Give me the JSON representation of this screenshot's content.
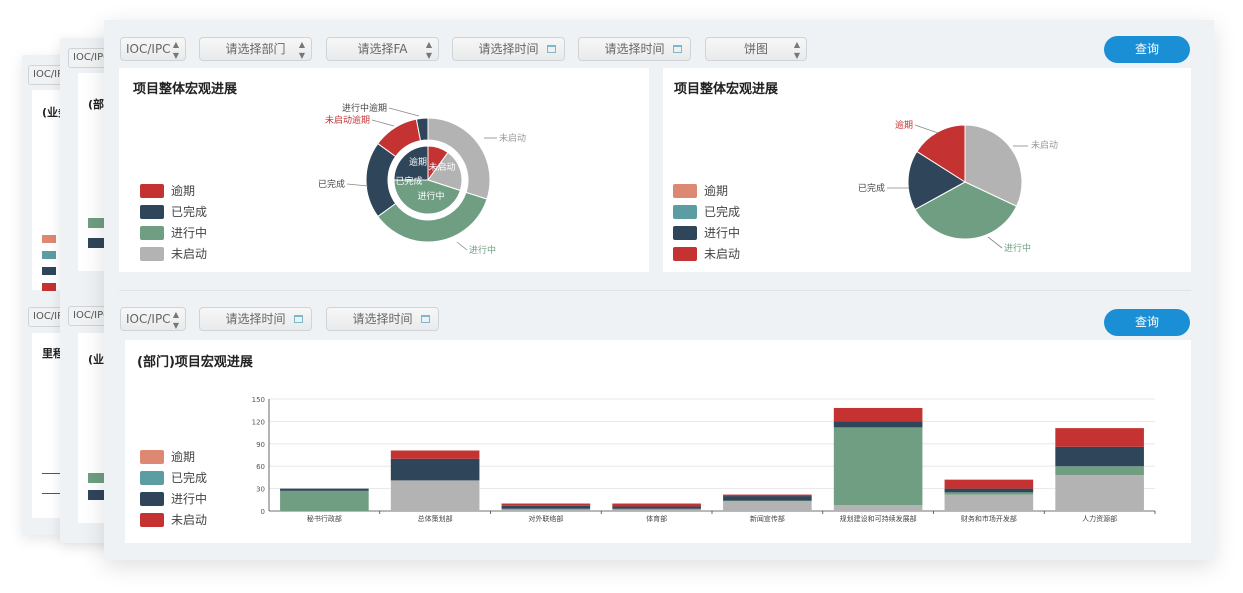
{
  "colors": {
    "overdue": "#c43232",
    "done": "#2f455a",
    "progress": "#6f9e82",
    "notstarted": "#b3b3b3",
    "overdue_light": "#dc8873",
    "done_light": "#5b9da3",
    "primary": "#1a8fd6"
  },
  "back_cards": {
    "card1": {
      "filter": "IOC/IPC",
      "title1": "(业务",
      "title2": "里程"
    },
    "card2": {
      "filter": "IOC/IPC",
      "title1": "(部门",
      "title2": "(业务"
    }
  },
  "filters_top": {
    "ioc": "IOC/IPC",
    "department": "请选择部门",
    "fa": "请选择FA",
    "time_start": "请选择时间",
    "time_end": "请选择时间",
    "chart_type": "饼图",
    "query": "查询"
  },
  "filters_bottom": {
    "ioc": "IOC/IPC",
    "time_start": "请选择时间",
    "time_end": "请选择时间",
    "query": "查询"
  },
  "panel_left": {
    "title": "项目整体宏观进展",
    "legend": [
      "逾期",
      "已完成",
      "进行中",
      "未启动"
    ],
    "outer_labels": {
      "in_progress_overdue": "进行中逾期",
      "notstarted_overdue": "未启动逾期",
      "done": "已完成",
      "notstarted": "未启动",
      "in_progress": "进行中"
    },
    "inner_labels": {
      "overdue": "逾期",
      "notstarted": "未启动",
      "done": "已完成",
      "in_progress": "进行中"
    }
  },
  "panel_right": {
    "title": "项目整体宏观进展",
    "legend": [
      "逾期",
      "已完成",
      "进行中",
      "未启动"
    ],
    "labels": {
      "overdue": "逾期",
      "notstarted": "未启动",
      "done": "已完成",
      "in_progress": "进行中"
    }
  },
  "panel_bottom": {
    "title": "(部门)项目宏观进展",
    "legend": [
      "逾期",
      "已完成",
      "进行中",
      "未启动"
    ]
  },
  "chart_data": [
    {
      "type": "pie",
      "title": "项目整体宏观进展",
      "rings": [
        {
          "name": "inner",
          "slices": [
            {
              "label": "逾期",
              "value": 10
            },
            {
              "label": "未启动",
              "value": 20
            },
            {
              "label": "进行中",
              "value": 45
            },
            {
              "label": "已完成",
              "value": 25
            }
          ]
        },
        {
          "name": "outer",
          "slices": [
            {
              "label": "未启动",
              "value": 30
            },
            {
              "label": "进行中",
              "value": 35
            },
            {
              "label": "已完成",
              "value": 20
            },
            {
              "label": "未启动逾期",
              "value": 12
            },
            {
              "label": "进行中逾期",
              "value": 3
            }
          ]
        }
      ]
    },
    {
      "type": "pie",
      "title": "项目整体宏观进展",
      "slices": [
        {
          "label": "未启动",
          "value": 32
        },
        {
          "label": "进行中",
          "value": 35
        },
        {
          "label": "已完成",
          "value": 17
        },
        {
          "label": "逾期",
          "value": 16
        }
      ]
    },
    {
      "type": "bar",
      "stacked": true,
      "title": "(部门)项目宏观进展",
      "ylim": [
        0,
        150
      ],
      "yticks": [
        0,
        30,
        60,
        90,
        120,
        150
      ],
      "categories": [
        "秘书行政部",
        "总体策划部",
        "对外联络部",
        "体育部",
        "新闻宣传部",
        "规划建设和可持续发展部",
        "财务和市场开发部",
        "人力资源部"
      ],
      "series": [
        {
          "name": "未启动",
          "values": [
            0,
            41,
            2,
            2,
            13,
            8,
            22,
            48
          ]
        },
        {
          "name": "进行中",
          "values": [
            27,
            0,
            1,
            1,
            1,
            104,
            3,
            12
          ]
        },
        {
          "name": "已完成",
          "values": [
            3,
            29,
            4,
            3,
            6,
            8,
            5,
            26
          ]
        },
        {
          "name": "逾期",
          "values": [
            0,
            11,
            3,
            4,
            2,
            18,
            12,
            25
          ]
        }
      ]
    }
  ]
}
